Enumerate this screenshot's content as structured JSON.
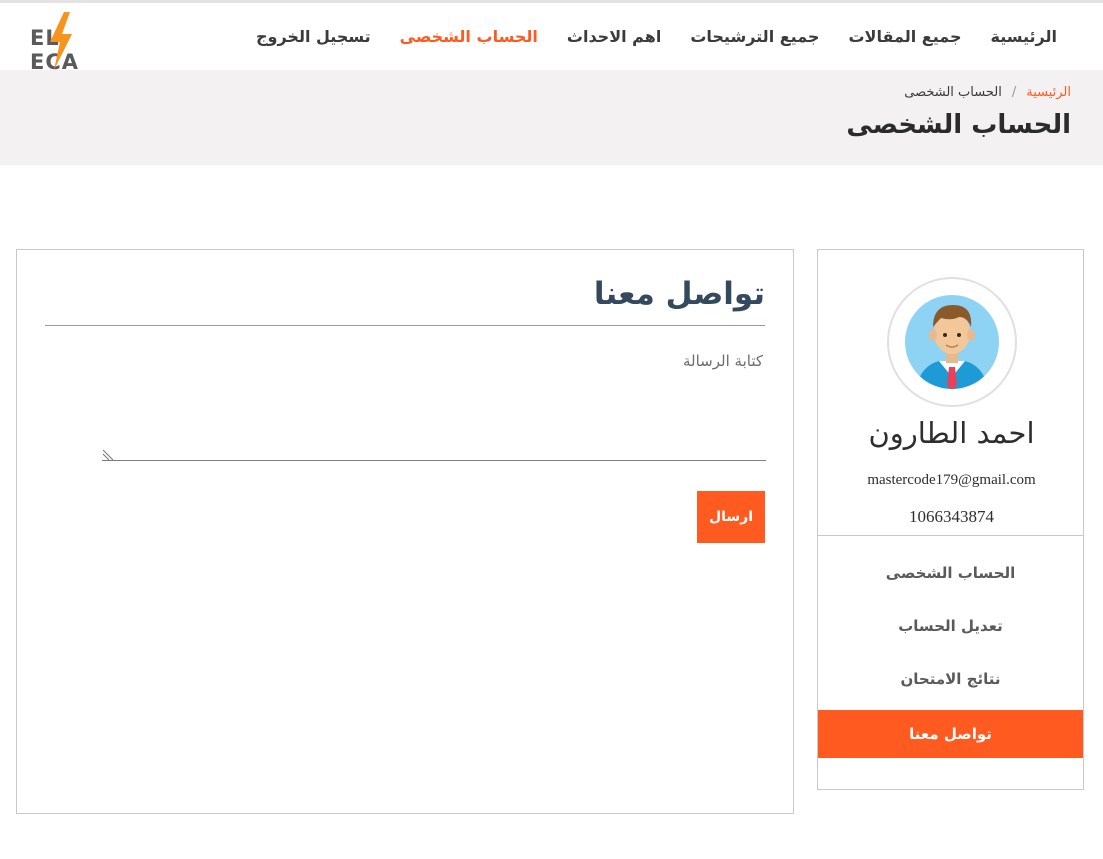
{
  "brand": {
    "logo_text_left": "EL",
    "logo_text_right": "ECA",
    "accent_color": "#ff5a1f"
  },
  "nav": {
    "items": [
      {
        "label": "الرئيسية",
        "active": false
      },
      {
        "label": "جميع المقالات",
        "active": false
      },
      {
        "label": "جميع الترشيحات",
        "active": false
      },
      {
        "label": "اهم الاحداث",
        "active": false
      },
      {
        "label": "الحساب الشخصى",
        "active": true
      },
      {
        "label": "تسجيل الخروج",
        "active": false
      }
    ]
  },
  "breadcrumb": {
    "home": "الرئيسية",
    "separator": "/",
    "current": "الحساب الشخصى"
  },
  "page": {
    "title": "الحساب الشخصى"
  },
  "contact": {
    "title": "تواصل معنا",
    "message_placeholder": "كتابة الرسالة",
    "message_value": "",
    "send_label": "ارسال"
  },
  "profile": {
    "name": "احمد الطارون",
    "email": "mastercode179@gmail.com",
    "phone": "1066343874",
    "menu": [
      {
        "label": "الحساب الشخصى",
        "active": false
      },
      {
        "label": "تعديل الحساب",
        "active": false
      },
      {
        "label": "نتائج الامتحان",
        "active": false
      },
      {
        "label": "تواصل معنا",
        "active": true
      }
    ]
  }
}
